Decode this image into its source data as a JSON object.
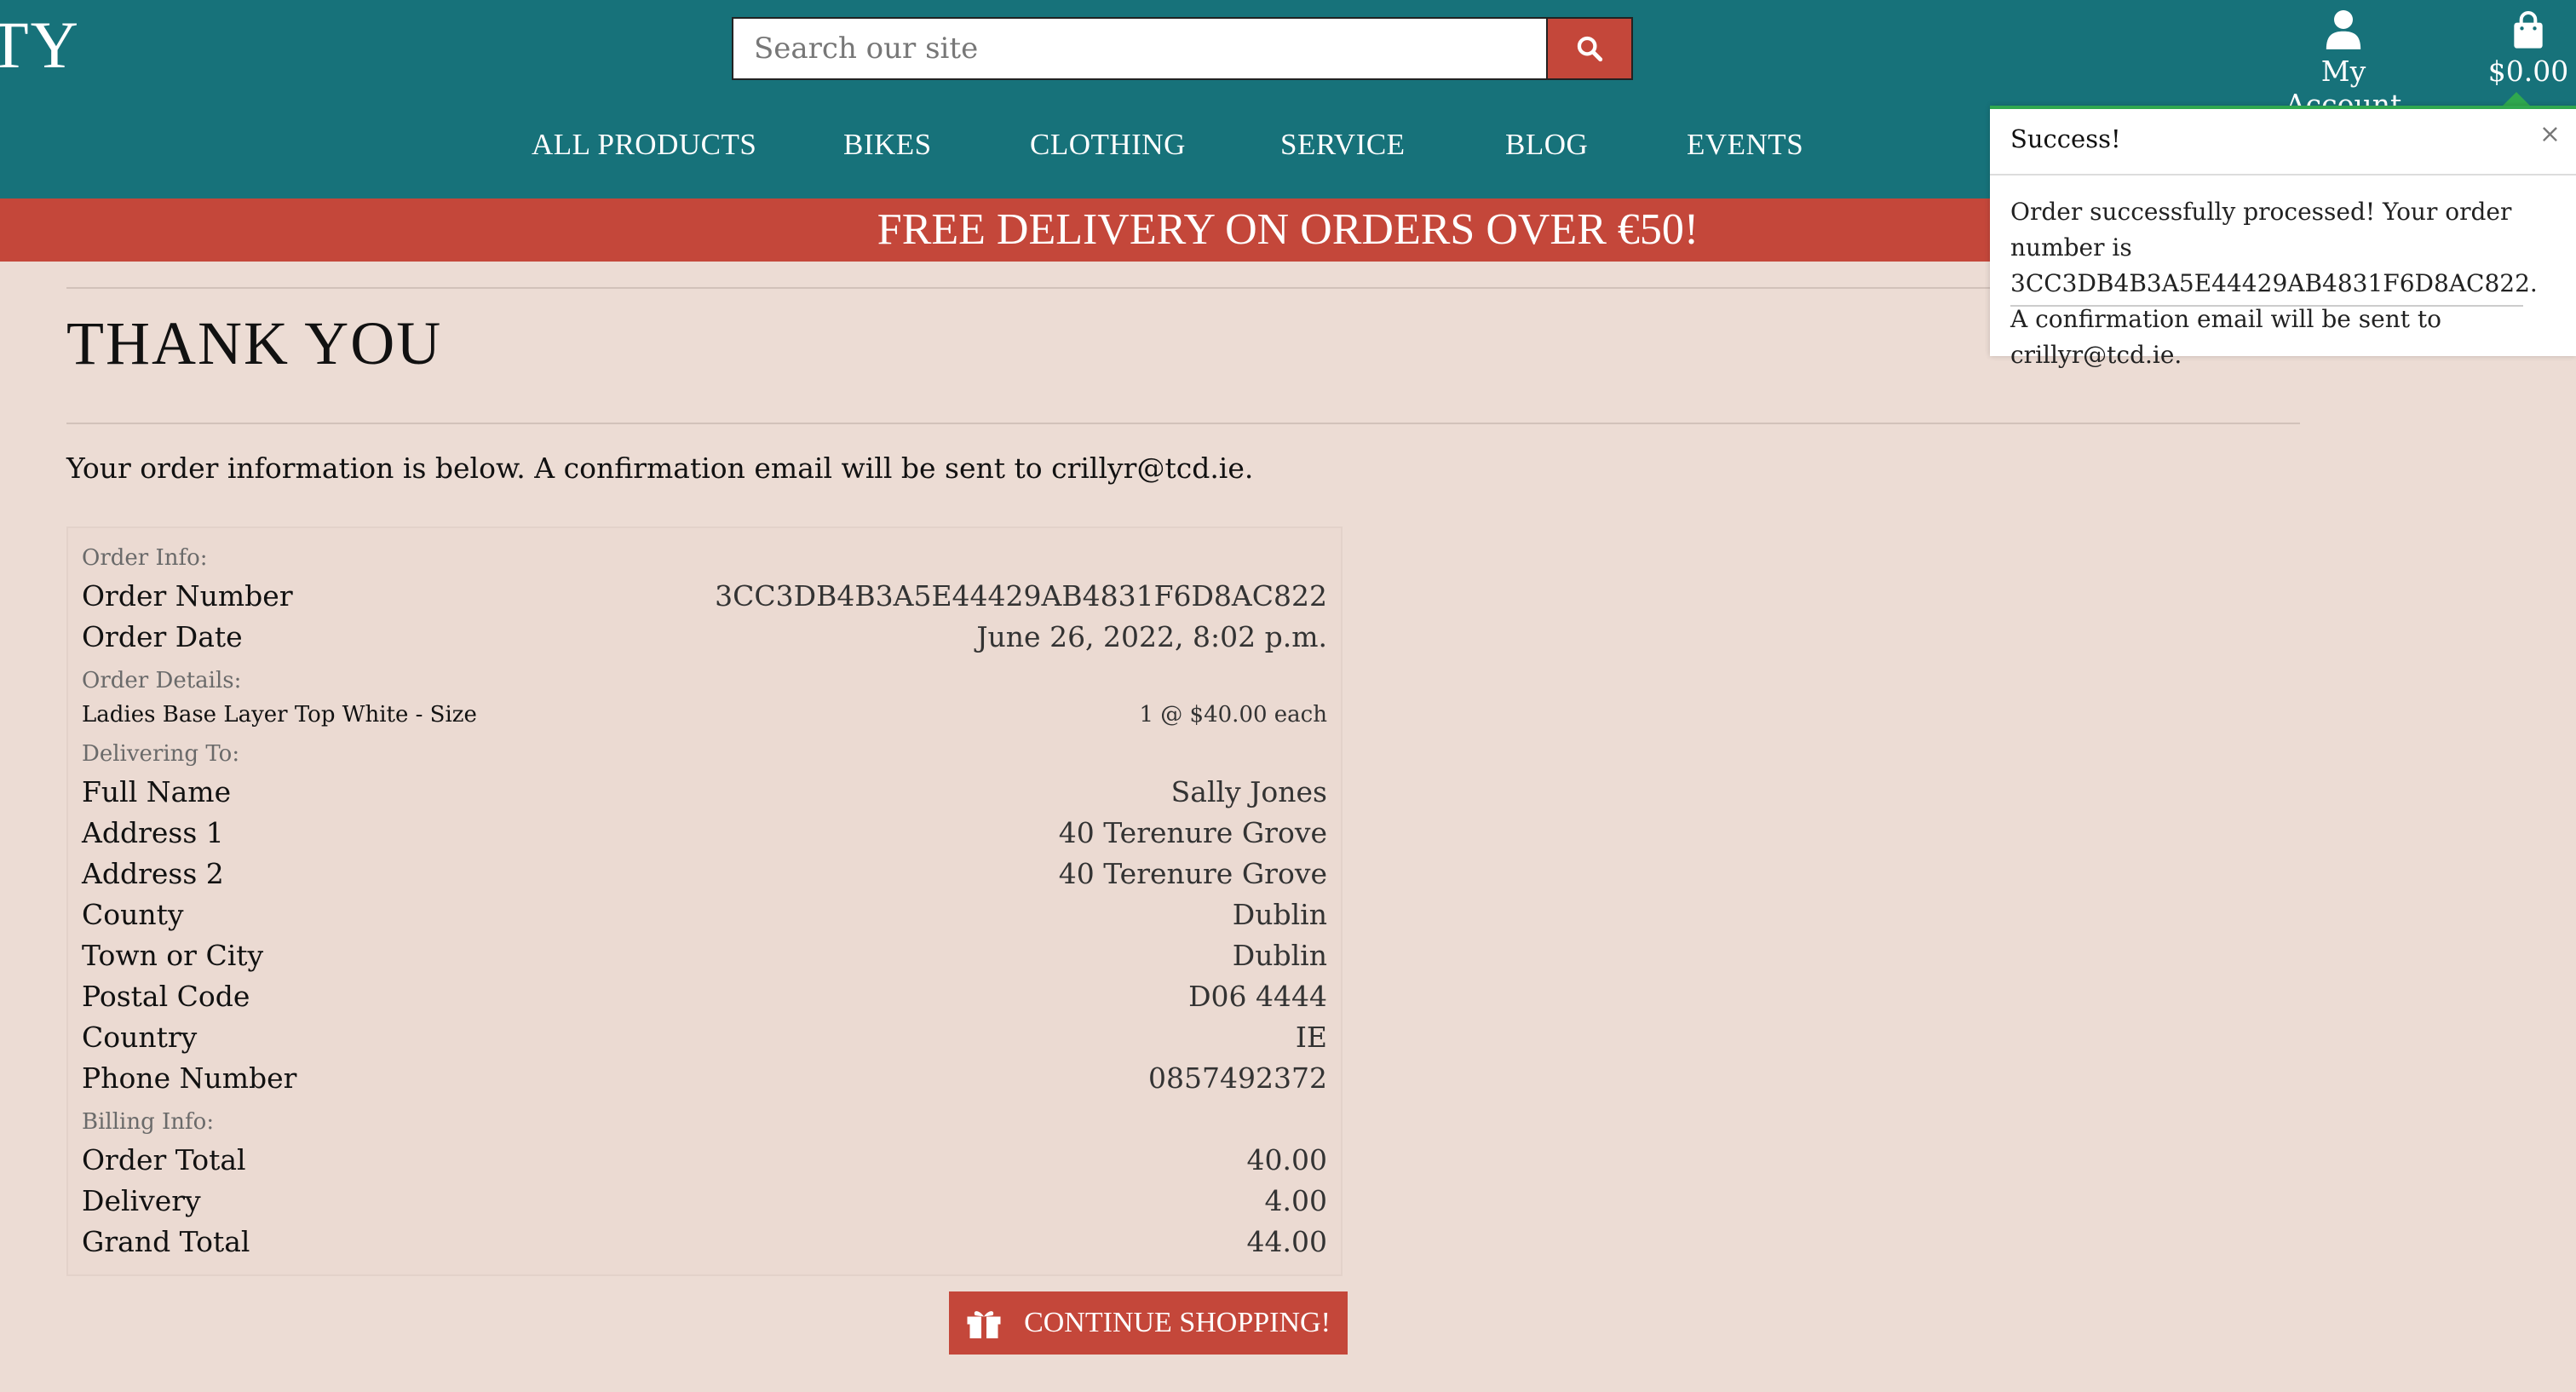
{
  "header": {
    "brand": "TY",
    "search": {
      "placeholder": "Search our site"
    },
    "account_label": "My Account",
    "bag_total": "$0.00"
  },
  "nav": {
    "items": [
      "ALL PRODUCTS",
      "BIKES",
      "CLOTHING",
      "SERVICE",
      "BLOG",
      "EVENTS"
    ]
  },
  "promo": "FREE DELIVERY ON ORDERS OVER €50!",
  "page": {
    "title": "THANK YOU",
    "intro": "Your order information is below. A confirmation email will be sent to crillyr@tcd.ie."
  },
  "order": {
    "info_heading": "Order Info:",
    "order_number_label": "Order Number",
    "order_number": "3CC3DB4B3A5E44429AB4831F6D8AC822",
    "order_date_label": "Order Date",
    "order_date": "June 26, 2022, 8:02 p.m.",
    "details_heading": "Order Details:",
    "item_name": "Ladies Base Layer Top White - Size",
    "item_qty": "1 @ $40.00 each",
    "delivering_heading": "Delivering To:",
    "full_name_label": "Full Name",
    "full_name": "Sally Jones",
    "address1_label": "Address 1",
    "address1": "40 Terenure Grove",
    "address2_label": "Address 2",
    "address2": "40 Terenure Grove",
    "county_label": "County",
    "county": "Dublin",
    "town_label": "Town or City",
    "town": "Dublin",
    "postal_label": "Postal Code",
    "postal": "D06 4444",
    "country_label": "Country",
    "country": "IE",
    "phone_label": "Phone Number",
    "phone": "0857492372",
    "billing_heading": "Billing Info:",
    "order_total_label": "Order Total",
    "order_total": "40.00",
    "delivery_label": "Delivery",
    "delivery": "4.00",
    "grand_total_label": "Grand Total",
    "grand_total": "44.00"
  },
  "cta_label": "CONTINUE SHOPPING!",
  "toast": {
    "title": "Success!",
    "close": "×",
    "message": "Order successfully processed! Your order number is 3CC3DB4B3A5E44429AB4831F6D8AC822. A confirmation email will be sent to crillyr@tcd.ie."
  },
  "colors": {
    "header": "#17727a",
    "accent": "#c4473a",
    "page_bg": "#ecdcd4",
    "success": "#2fa84f"
  }
}
